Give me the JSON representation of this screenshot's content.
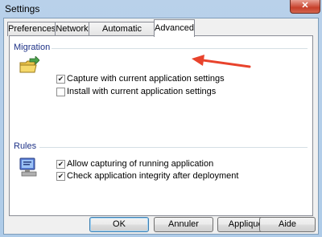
{
  "window": {
    "title": "Settings",
    "close_glyph": "✕"
  },
  "tabs": [
    "Preferences",
    "Network",
    "Automatic Updates",
    "Advanced"
  ],
  "active_tab": "Advanced",
  "migration": {
    "label": "Migration",
    "icon": "folder-migration-icon",
    "options": [
      {
        "label": "Capture with current application settings",
        "checked": true
      },
      {
        "label": "Install with current application settings",
        "checked": false
      }
    ]
  },
  "rules": {
    "label": "Rules",
    "icon": "monitor-rules-icon",
    "options": [
      {
        "label": "Allow capturing of running application",
        "checked": true
      },
      {
        "label": "Check application integrity after deployment",
        "checked": true
      }
    ]
  },
  "annotation": {
    "arrow_color": "#e8432c"
  },
  "buttons": {
    "ok": "OK",
    "cancel": "Annuler",
    "apply": "Appliquer",
    "help": "Aide"
  },
  "checkmark": "✔"
}
